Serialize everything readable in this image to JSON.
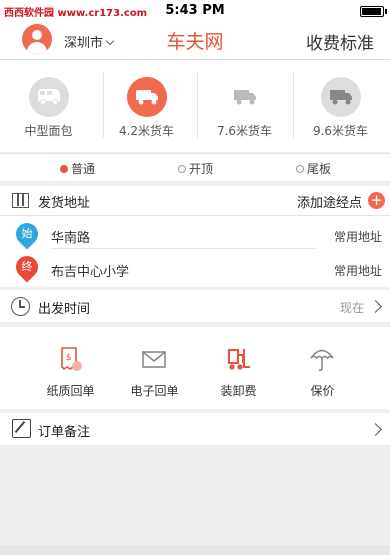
{
  "status_bar": {
    "watermark": "西西软件园 www.cr173.com",
    "time": "5:43 PM"
  },
  "nav": {
    "city": "深圳市",
    "brand": "车夫网",
    "pricing": "收费标准"
  },
  "vehicles": [
    {
      "label": "中型面包",
      "icon": "van-icon",
      "active": false
    },
    {
      "label": "4.2米货车",
      "icon": "truck-icon",
      "active": true
    },
    {
      "label": "7.6米货车",
      "icon": "truck-icon",
      "active": false
    },
    {
      "label": "9.6米货车",
      "icon": "truck-icon",
      "active": false
    }
  ],
  "options": [
    {
      "label": "普通",
      "checked": true
    },
    {
      "label": "开顶",
      "checked": false
    },
    {
      "label": "尾板",
      "checked": false
    }
  ],
  "address": {
    "title": "发货地址",
    "add_stop": "添加途经点",
    "plus": "+",
    "start_tag": "始",
    "start": "华南路",
    "start_common": "常用地址",
    "end_tag": "终",
    "end": "布吉中心小学",
    "end_common": "常用地址"
  },
  "departure": {
    "title": "出发时间",
    "value": "现在"
  },
  "services": [
    {
      "label": "纸质回单",
      "icon": "paper-receipt-icon"
    },
    {
      "label": "电子回单",
      "icon": "email-receipt-icon"
    },
    {
      "label": "装卸费",
      "icon": "forklift-icon"
    },
    {
      "label": "保价",
      "icon": "umbrella-icon"
    }
  ],
  "notes": {
    "title": "订单备注"
  },
  "colors": {
    "accent": "#e8533a",
    "start_pin": "#2ea7e0",
    "end_pin": "#e84a3a"
  }
}
